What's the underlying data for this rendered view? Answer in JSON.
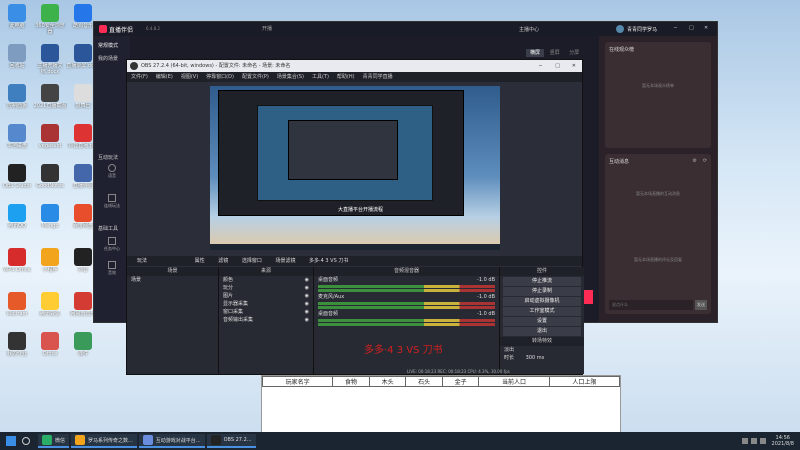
{
  "desktop": {
    "icons": [
      {
        "label": "此电脑",
        "color": "#3a8ee6"
      },
      {
        "label": "360安全浏览器",
        "color": "#3db24a"
      },
      {
        "label": "酷狗音乐",
        "color": "#2576e8"
      },
      {
        "label": "回收站",
        "color": "#7d9cbf"
      },
      {
        "label": "主播开播文档.docx",
        "color": "#2b579a"
      },
      {
        "label": "直播录屏.docx",
        "color": "#2b579a"
      },
      {
        "label": "控制面板",
        "color": "#3f7fbf"
      },
      {
        "label": "2021直播截图",
        "color": "#444"
      },
      {
        "label": "鼓舞巴",
        "color": "#ddd"
      },
      {
        "label": "本地磁盘",
        "color": "#5588cc"
      },
      {
        "label": "vegasvid",
        "color": "#aa3333"
      },
      {
        "label": "抖音直播.pdf",
        "color": "#d33"
      },
      {
        "label": "OBS Studio",
        "color": "#222"
      },
      {
        "label": "GoodNotes",
        "color": "#333"
      },
      {
        "label": "直播伴侣",
        "color": "#4466aa"
      },
      {
        "label": "腾讯QQ",
        "color": "#1ea0f1"
      },
      {
        "label": "Mango",
        "color": "#2a8be6"
      },
      {
        "label": "百度网盘",
        "color": "#e84d2c"
      },
      {
        "label": "WPS Office",
        "color": "#d62c2c"
      },
      {
        "label": "小程序",
        "color": "#f1a41c"
      },
      {
        "label": "抖音",
        "color": "#222"
      },
      {
        "label": "Wolfram",
        "color": "#e65a2a"
      },
      {
        "label": "腾讯会议",
        "color": "#ffcc33"
      },
      {
        "label": "网易云音乐",
        "color": "#d43c33"
      },
      {
        "label": "我的作业",
        "color": "#333"
      },
      {
        "label": "Office",
        "color": "#d9534f"
      },
      {
        "label": "课件",
        "color": "#3a9a5a"
      }
    ]
  },
  "livehelper": {
    "app_title": "直播伴侣",
    "version": "6.4.8.2",
    "tab_title": "开播",
    "mode_label": "常规模式",
    "stats_label": "我的场景",
    "user_name": "青青同学罗马",
    "controls": {
      "min": "─",
      "max": "□",
      "close": "✕"
    },
    "left_sections": [
      {
        "label": "互动玩法"
      },
      {
        "label": "基础工具"
      }
    ],
    "left_tools": [
      "语音",
      "连线玩法",
      "任务中心",
      "音效"
    ],
    "top_tabs": [
      "横屏",
      "竖屏",
      "分屏"
    ],
    "header_right": "主播中心",
    "online_title": "在线观众榜",
    "online_empty": "暂无本场观众榜单",
    "interaction_title": "互动消息",
    "interaction_empty1": "暂无本场直播的互动消息",
    "interaction_empty2": "暂无本场直播的评论及回复",
    "chat_placeholder": "说点什么",
    "send_label": "发送",
    "top_bar_items": [
      "常规模式",
      "横屏",
      "青青同学罗马"
    ]
  },
  "obs": {
    "title": "OBS 27.2.4 (64-bit, windows) - 配置文件: 未命名 - 场景: 未命名",
    "menu": [
      "文件(F)",
      "编辑(E)",
      "视图(V)",
      "停靠窗口(D)",
      "配置文件(P)",
      "场景集合(S)",
      "工具(T)",
      "帮助(H)",
      "青青同学直播"
    ],
    "scene_bar": {
      "scene_name": "玩法",
      "properties": "属性",
      "filters": "滤镜",
      "select_window": "选择窗口",
      "scene_filter": "场景滤镜",
      "title_text": "多多·4 3 VS 刀书"
    },
    "docks": {
      "scenes": {
        "title": "场景",
        "items": [
          "场景"
        ]
      },
      "sources": {
        "title": "来源",
        "items": [
          "颜色",
          "玩分",
          "图片",
          "显示器采集",
          "窗口采集",
          "音频输出采集"
        ]
      },
      "mixer": {
        "title": "音频混音器",
        "items": [
          {
            "name": "桌面音频",
            "level": "-1.0 dB"
          },
          {
            "name": "麦克风/Aux",
            "level": "-1.0 dB"
          },
          {
            "name": "桌面音频",
            "level": "-1.0 dB"
          }
        ]
      },
      "controls": {
        "title": "控件",
        "buttons": [
          "停止推流",
          "停止录制",
          "启动虚拟摄像机",
          "工作室模式",
          "设置",
          "退出"
        ]
      },
      "transitions": {
        "title": "转场特效",
        "type": "淡出",
        "duration_label": "时长",
        "duration": "300 ms"
      }
    },
    "overlay_text": "多多·4 3 VS 刀书",
    "preview_caption": "大直播平台开播流程",
    "status": "LIVE: 00:18:23  REC: 00:18:23  CPU: 4.3%, 30.00 fps"
  },
  "table_window": {
    "headers": [
      "玩家名字",
      "食物",
      "木头",
      "石头",
      "金子",
      "当前人口",
      "人口上限"
    ]
  },
  "taskbar": {
    "items": [
      {
        "label": "微信",
        "color": "#2aae67"
      },
      {
        "label": "罗马系列传奇之数...",
        "color": "#f1a41c"
      },
      {
        "label": "互动游戏对战平台...",
        "color": "#6a8de0"
      },
      {
        "label": "OBS 27.2...",
        "color": "#222"
      }
    ],
    "time": "14:56",
    "date": "2021/8/8"
  }
}
